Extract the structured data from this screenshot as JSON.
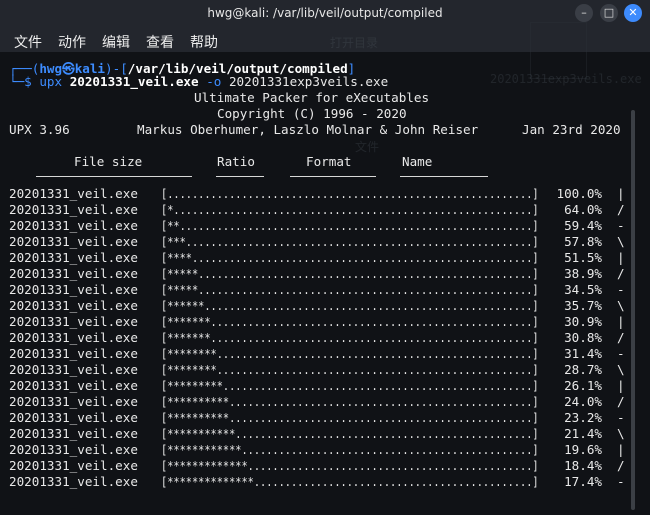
{
  "window": {
    "title": "hwg@kali: /var/lib/veil/output/compiled",
    "min_glyph": "–",
    "max_glyph": "□",
    "close_glyph": "✕"
  },
  "menu": [
    "文件",
    "动作",
    "编辑",
    "查看",
    "帮助"
  ],
  "ghost": {
    "overlay_text_1": "20201331exp3veils.exe",
    "overlay_text_2": "打开目录",
    "overlay_text_3": "文件"
  },
  "prompt": {
    "line1_prefix": "┌──(",
    "user": "hwg",
    "at": "㉿",
    "host": "kali",
    "sep": ")-[",
    "path": "/var/lib/veil/output/compiled",
    "close": "]",
    "line2_prefix": "└─$ ",
    "command": "upx",
    "arg1": "20201331_veil.exe",
    "flag": "-o",
    "arg2": "20201331exp3veils.exe"
  },
  "banner": {
    "line1": "Ultimate Packer for eXecutables",
    "line2": "Copyright (C) 1996 - 2020",
    "version": "UPX 3.96",
    "authors": "Markus Oberhumer, Laszlo Molnar & John Reiser",
    "date": "Jan 23rd 2020"
  },
  "columns": [
    "File size",
    "Ratio",
    "Format",
    "Name"
  ],
  "rows": [
    {
      "name": "20201331_veil.exe",
      "bar": "[...........................................................]",
      "pct": "100.0%",
      "spin": "|"
    },
    {
      "name": "20201331_veil.exe",
      "bar": "[*..........................................................]",
      "pct": "64.0%",
      "spin": "/"
    },
    {
      "name": "20201331_veil.exe",
      "bar": "[**.........................................................]",
      "pct": "59.4%",
      "spin": "-"
    },
    {
      "name": "20201331_veil.exe",
      "bar": "[***........................................................]",
      "pct": "57.8%",
      "spin": "\\"
    },
    {
      "name": "20201331_veil.exe",
      "bar": "[****.......................................................]",
      "pct": "51.5%",
      "spin": "|"
    },
    {
      "name": "20201331_veil.exe",
      "bar": "[*****......................................................]",
      "pct": "38.9%",
      "spin": "/"
    },
    {
      "name": "20201331_veil.exe",
      "bar": "[*****......................................................]",
      "pct": "34.5%",
      "spin": "-"
    },
    {
      "name": "20201331_veil.exe",
      "bar": "[******.....................................................]",
      "pct": "35.7%",
      "spin": "\\"
    },
    {
      "name": "20201331_veil.exe",
      "bar": "[*******....................................................]",
      "pct": "30.9%",
      "spin": "|"
    },
    {
      "name": "20201331_veil.exe",
      "bar": "[*******....................................................]",
      "pct": "30.8%",
      "spin": "/"
    },
    {
      "name": "20201331_veil.exe",
      "bar": "[********...................................................]",
      "pct": "31.4%",
      "spin": "-"
    },
    {
      "name": "20201331_veil.exe",
      "bar": "[********...................................................]",
      "pct": "28.7%",
      "spin": "\\"
    },
    {
      "name": "20201331_veil.exe",
      "bar": "[*********..................................................]",
      "pct": "26.1%",
      "spin": "|"
    },
    {
      "name": "20201331_veil.exe",
      "bar": "[**********.................................................]",
      "pct": "24.0%",
      "spin": "/"
    },
    {
      "name": "20201331_veil.exe",
      "bar": "[**********.................................................]",
      "pct": "23.2%",
      "spin": "-"
    },
    {
      "name": "20201331_veil.exe",
      "bar": "[***********................................................]",
      "pct": "21.4%",
      "spin": "\\"
    },
    {
      "name": "20201331_veil.exe",
      "bar": "[************...............................................]",
      "pct": "19.6%",
      "spin": "|"
    },
    {
      "name": "20201331_veil.exe",
      "bar": "[*************..............................................]",
      "pct": "18.4%",
      "spin": "/"
    },
    {
      "name": "20201331_veil.exe",
      "bar": "[**************.............................................]",
      "pct": "17.4%",
      "spin": "-"
    }
  ],
  "colors": {
    "accent": "#3d8cff",
    "terminal_bg": "#101216",
    "titlebar_bg": "#23262d",
    "close_button": "#3d8bfd"
  }
}
